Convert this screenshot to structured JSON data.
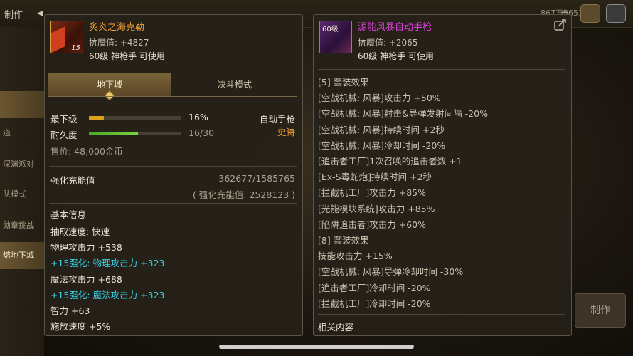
{
  "background": {
    "title": "制作",
    "server": "867万5651",
    "left_menu": [
      "",
      "",
      "道",
      "深渊派对",
      "队模式",
      "勋章挑战",
      "熔地下城"
    ],
    "make_button": "制作"
  },
  "left_item": {
    "name": "炙炎之海克勒",
    "icon_level": "15",
    "stat": "抗魔值: +4827",
    "requirement": "60级 神枪手 可使用",
    "tabs": [
      "地下城",
      "决斗模式"
    ],
    "min_level_label": "最下级",
    "min_level_percent": "16%",
    "min_level_fraction": 0.16,
    "durability_label": "耐久度",
    "durability_value": "16/30",
    "durability_fraction": 0.533,
    "type": "自动手枪",
    "rarity": "史诗",
    "price": "售价: 48,000金币",
    "enhance_label": "强化充能值",
    "enhance_value": "362677/1585765",
    "enhance_sub": "( 强化充能值: 2528123 )",
    "basic_info_title": "基本信息",
    "basic_info": [
      {
        "text": "抽取速度: 快速",
        "style": "normal"
      },
      {
        "text": "物理攻击力 +538",
        "style": "normal"
      },
      {
        "text": "+15强化: 物理攻击力 +323",
        "style": "cyan"
      },
      {
        "text": "魔法攻击力 +688",
        "style": "normal"
      },
      {
        "text": "+15强化: 魔法攻击力 +323",
        "style": "cyan"
      },
      {
        "text": "智力 +63",
        "style": "normal"
      },
      {
        "text": "施放速度 +5%",
        "style": "normal"
      }
    ]
  },
  "right_item": {
    "name": "源能风暴自动手枪",
    "icon_top": "60级",
    "stat": "抗魔值: +2065",
    "requirement": "60级 神枪手 可使用",
    "set_lines": [
      "[5] 套装效果",
      "[空战机械: 风暴]攻击力 +50%",
      "[空战机械: 风暴]射击&导弹发射间隔 -20%",
      "[空战机械: 风暴]持续时间 +2秒",
      "[空战机械: 风暴]冷却时间 -20%",
      "[追击者工厂]1次召唤的追击者数 +1",
      "[Ex-S毒蛇炮]持续时间 +2秒",
      "[拦截机工厂]攻击力 +85%",
      "[光能模块系统]攻击力 +85%",
      "[陷阱追击者]攻击力 +60%",
      "[8] 套装效果",
      "技能攻击力 +15%",
      "[空战机械: 风暴]导弹冷却时间 -30%",
      "[追击者工厂]冷却时间 -20%",
      "[拦截机工厂]冷却时间 -20%"
    ],
    "related_title": "相关内容"
  },
  "colors": {
    "epic_orange": "#f0a030",
    "pink_name": "#e040e0",
    "enhance_cyan": "#3ad0e8"
  }
}
